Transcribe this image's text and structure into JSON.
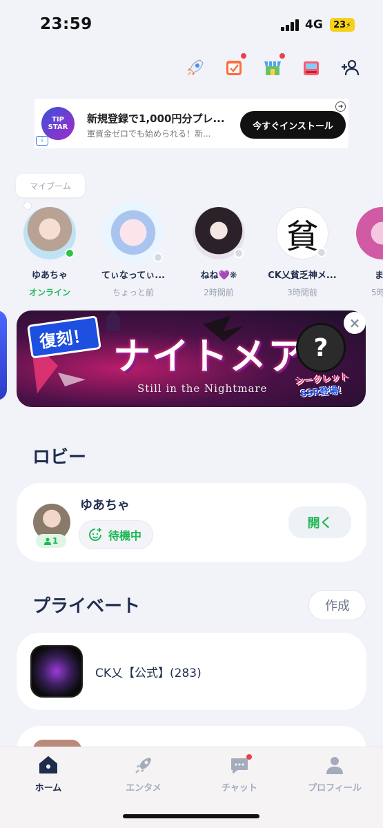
{
  "status": {
    "time": "23:59",
    "network": "4G",
    "battery": "23"
  },
  "ad": {
    "logo_text": "TIP STAR",
    "info_icon": "i",
    "title": "新規登録で1,000円分プレ...",
    "subtitle": "軍資金ゼロでも始められる！新...",
    "cta": "今すぐインストール"
  },
  "my_boom": {
    "label": "マイブーム"
  },
  "friends": [
    {
      "name": "ゆあちゃ",
      "status": "オンライン",
      "online": true
    },
    {
      "name": "てぃなってぃ...",
      "status": "ちょっと前",
      "online": false
    },
    {
      "name": "ねね💜❋",
      "status": "2時間前",
      "online": false
    },
    {
      "name": "CK乂貧乏神メ...",
      "status": "3時間前",
      "online": false
    },
    {
      "name": "ま",
      "status": "5時",
      "online": false
    }
  ],
  "friend_avatar_glyph_4": "貧",
  "event_banner": {
    "tag": "復刻！",
    "title": "ナイトメア",
    "subtitle": "Still in the Nightmare",
    "mystery": "?",
    "secret_line1": "シークレット",
    "secret_line2": "SSR登場！",
    "close": "×"
  },
  "lobby": {
    "section_title": "ロビー",
    "user_name": "ゆあちゃ",
    "member_count": "1",
    "status": "待機中",
    "open_button": "開く"
  },
  "private": {
    "section_title": "プライベート",
    "create_button": "作成",
    "groups": [
      {
        "name": "CK乂【公式】(283)"
      }
    ]
  },
  "tabs": [
    {
      "label": "ホーム",
      "active": true
    },
    {
      "label": "エンタメ",
      "active": false
    },
    {
      "label": "チャット",
      "active": false,
      "badge": true
    },
    {
      "label": "プロフィール",
      "active": false
    }
  ],
  "colors": {
    "accent_green": "#1fb855",
    "text_dark": "#1f2d4d",
    "badge_red": "#e8424a"
  }
}
